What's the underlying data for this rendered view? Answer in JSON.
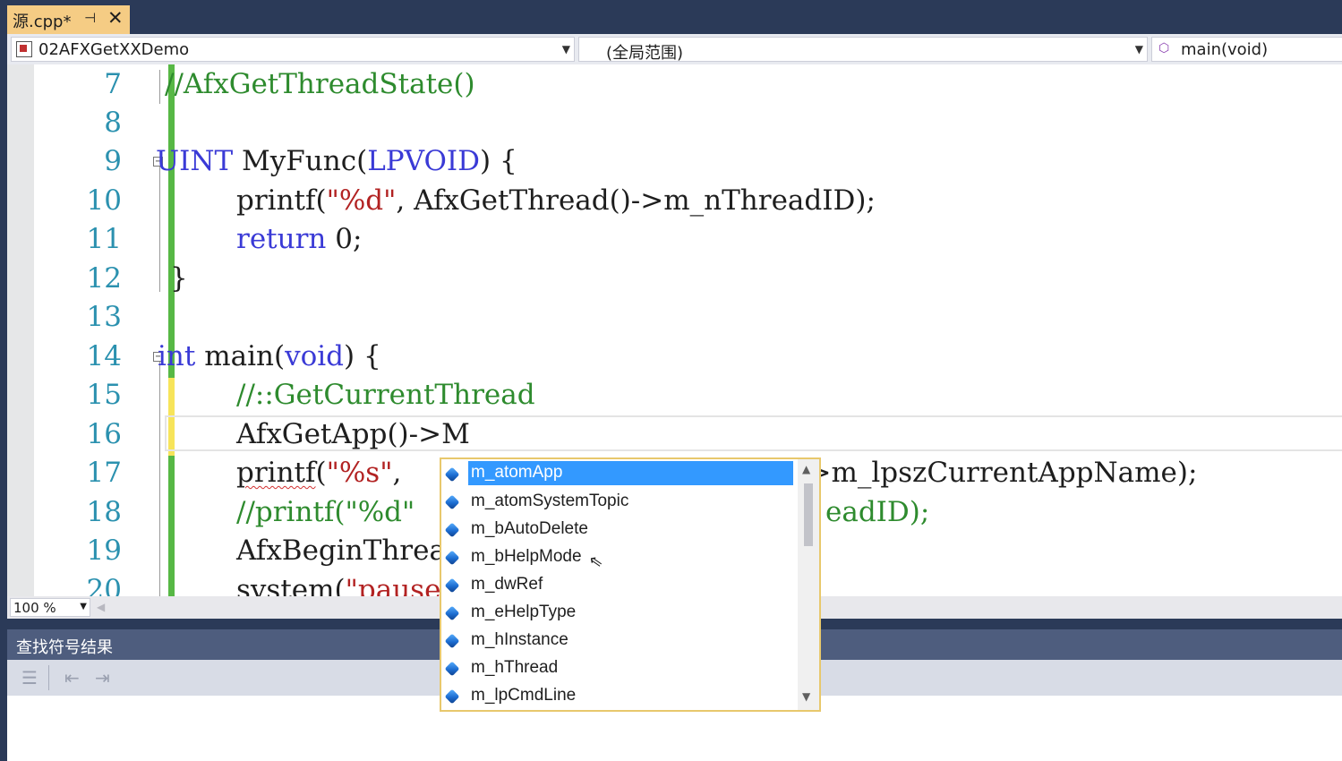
{
  "tab": {
    "title": "源.cpp*",
    "pin": "⊣",
    "close": "✕"
  },
  "nav": {
    "project": "02AFXGetXXDemo",
    "scope": "(全局范围)",
    "member": "main(void)"
  },
  "editor": {
    "line_numbers": [
      "7",
      "8",
      "9",
      "10",
      "11",
      "12",
      "13",
      "14",
      "15",
      "16",
      "17",
      "18",
      "19",
      "20"
    ],
    "lines": {
      "l7": {
        "c": "//AfxGetThreadState()"
      },
      "l9": {
        "k1": "UINT",
        "t1": " MyFunc(",
        "k2": "LPVOID",
        "t2": ") {"
      },
      "l10": {
        "t1": "printf(",
        "s1": "\"%d\"",
        "t2": ", AfxGetThread()->m_nThreadID);"
      },
      "l11": {
        "k1": "return",
        "t1": " 0;"
      },
      "l12": {
        "t1": "}"
      },
      "l14": {
        "k1": "int",
        "t1": " main(",
        "k2": "void",
        "t2": ") {"
      },
      "l15": {
        "c": "//::GetCurrentThread"
      },
      "l16": {
        "t1": "AfxGetApp()->M"
      },
      "l17": {
        "t1": "printf",
        "t2": "(",
        "s1": "\"%s\"",
        "t3": ",",
        "t4": "->m_lpszCurrentAppName);"
      },
      "l18": {
        "c1": "//printf(\"%d\"",
        "c2": "eadID);"
      },
      "l19": {
        "t1": "AfxBeginThrea"
      },
      "l20": {
        "t1": "system(",
        "s1": "\"pause"
      }
    }
  },
  "zoom": {
    "value": "100 %"
  },
  "panel": {
    "title": "查找符号结果"
  },
  "intellisense": {
    "items": [
      {
        "label": "m_atomApp",
        "selected": true
      },
      {
        "label": "m_atomSystemTopic"
      },
      {
        "label": "m_bAutoDelete"
      },
      {
        "label": "m_bHelpMode"
      },
      {
        "label": "m_dwRef"
      },
      {
        "label": "m_eHelpType"
      },
      {
        "label": "m_hInstance"
      },
      {
        "label": "m_hThread"
      },
      {
        "label": "m_lpCmdLine"
      }
    ]
  },
  "colors": {
    "keyword": "#3a3ad6",
    "comment": "#2e8b2e",
    "string": "#b22222",
    "selection": "#3399ff",
    "tab_active": "#f5cc84"
  }
}
